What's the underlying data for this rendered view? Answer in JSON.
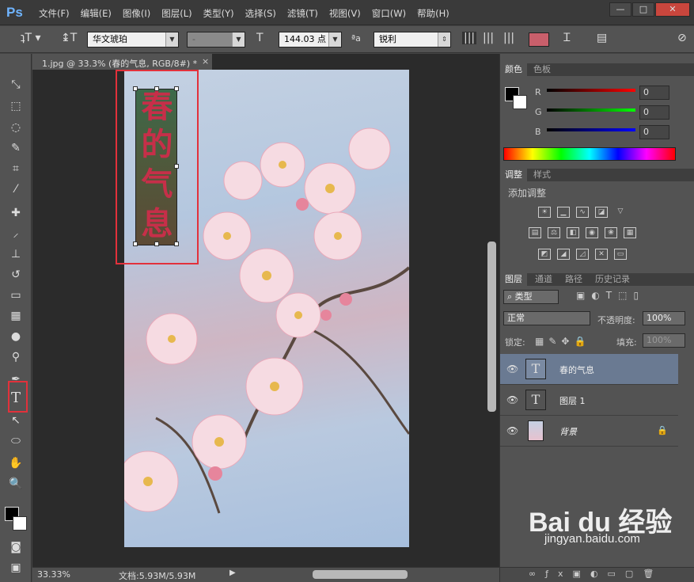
{
  "app": {
    "logo": "Ps"
  },
  "menu": [
    "文件(F)",
    "编辑(E)",
    "图像(I)",
    "图层(L)",
    "类型(Y)",
    "选择(S)",
    "滤镜(T)",
    "视图(V)",
    "窗口(W)",
    "帮助(H)"
  ],
  "window_controls": {
    "minimize": "—",
    "restore": "□",
    "close": "✕"
  },
  "options": {
    "font_family": "华文琥珀",
    "font_style": "-",
    "font_size": "144.03 点",
    "antialias": "锐利",
    "text_color": "#c95f6b"
  },
  "document": {
    "tab_title": "1.jpg @ 33.3% (春的气息, RGB/8#) *",
    "text_glyphs": [
      "春",
      "的",
      "气",
      "息"
    ],
    "zoom": "33.33%",
    "doc_size": "文档:5.93M/5.93M"
  },
  "color_panel": {
    "tabs": [
      "颜色",
      "色板"
    ],
    "channels": [
      {
        "label": "R",
        "value": "0"
      },
      {
        "label": "G",
        "value": "0"
      },
      {
        "label": "B",
        "value": "0"
      }
    ]
  },
  "adjust_panel": {
    "tabs": [
      "调整",
      "样式"
    ],
    "title": "添加调整"
  },
  "layers_panel": {
    "tabs": [
      "图层",
      "通道",
      "路径",
      "历史记录"
    ],
    "filter_kind": "类型",
    "blend_mode": "正常",
    "opacity_label": "不透明度:",
    "opacity": "100%",
    "lock_label": "锁定:",
    "fill_label": "填充:",
    "fill": "100%",
    "layers": [
      {
        "name": "春的气息",
        "type": "text",
        "selected": true
      },
      {
        "name": "图层 1",
        "type": "text",
        "selected": false
      },
      {
        "name": "背景",
        "type": "image",
        "selected": false
      }
    ]
  },
  "watermark": {
    "brand": "Bai du 经验",
    "url": "jingyan.baidu.com"
  }
}
